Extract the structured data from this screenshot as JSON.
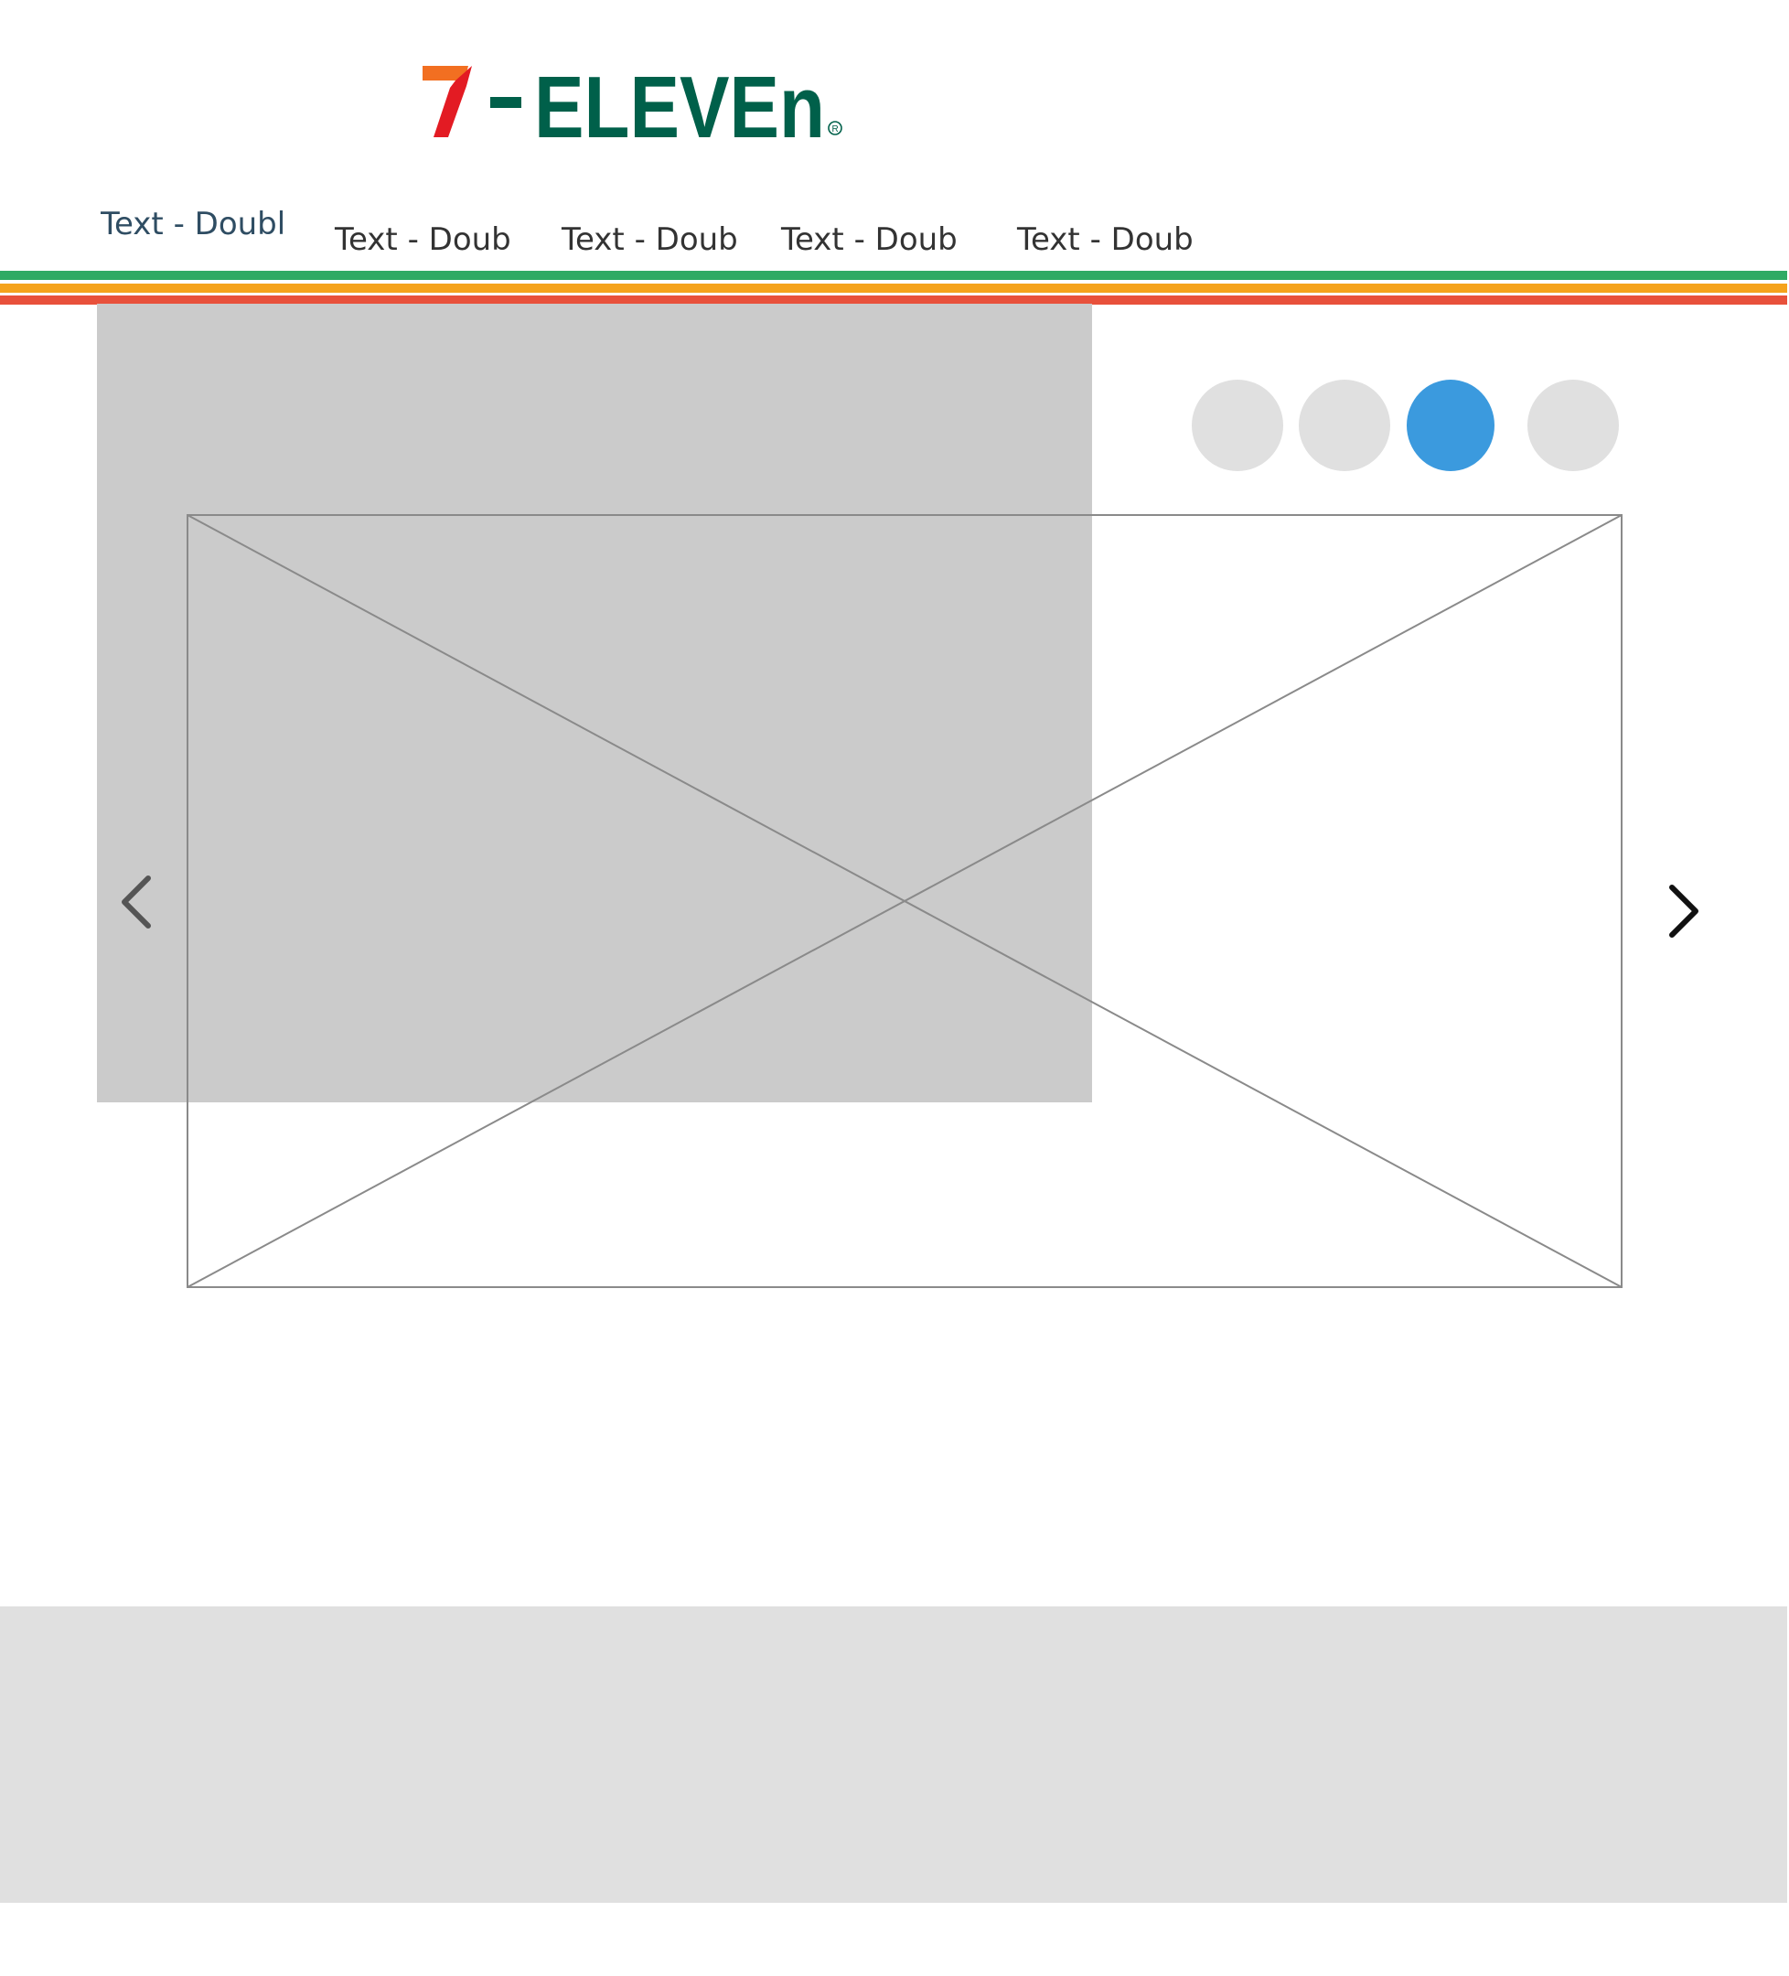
{
  "logo": {
    "text": "7-ELEVEn",
    "colors": {
      "seven_orange": "#f26f21",
      "seven_red": "#e31b23",
      "wordmark_green": "#00604a"
    }
  },
  "nav": {
    "items": [
      {
        "label": "Text - Doubl",
        "sublabel": "...",
        "active": true
      },
      {
        "label": "Text - Doub"
      },
      {
        "label": "Text - Doub"
      },
      {
        "label": "Text - Doub"
      },
      {
        "label": "Text - Doub"
      }
    ]
  },
  "stripes": {
    "green": "#2eaa64",
    "orange": "#f5a31c",
    "red": "#e8513b"
  },
  "hero": {
    "gray_block_color": "#cbcbcb",
    "placeholder_line_color": "#8a8a8a",
    "prev_icon": "chevron-left-icon",
    "next_icon": "chevron-right-icon"
  },
  "carousel": {
    "slide_count": 4,
    "current_index": 2,
    "dot_color": "#e0e0e0",
    "active_dot_color": "#3b9ade"
  },
  "footer": {
    "band_color": "#e0e0e0"
  }
}
